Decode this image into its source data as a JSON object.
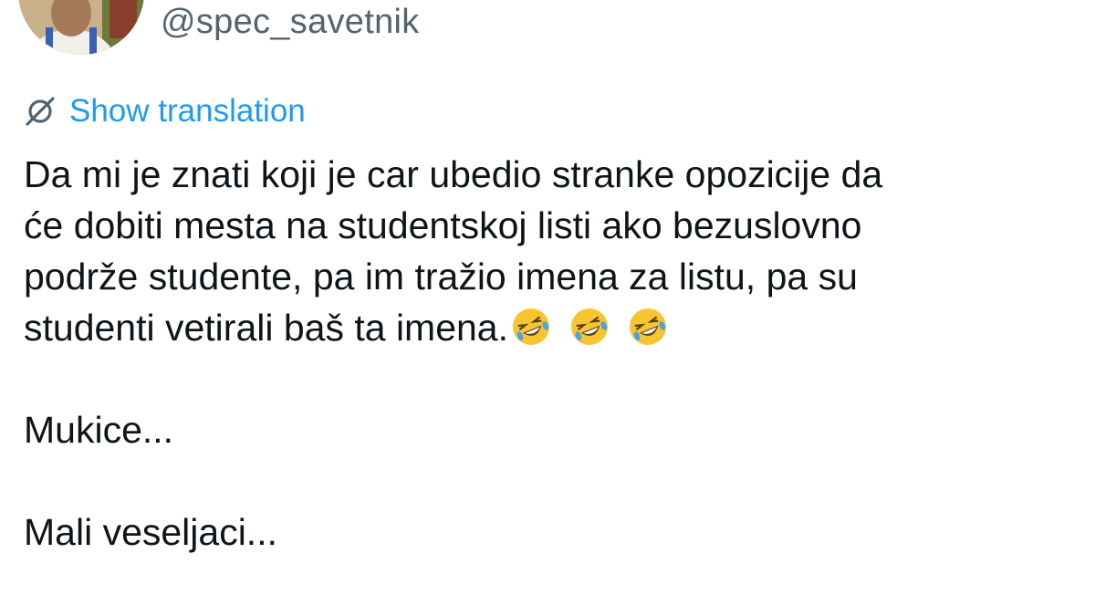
{
  "author": {
    "handle": "@spec_savetnik",
    "avatar_icon": "avatar-photo"
  },
  "translation": {
    "label": "Show translation",
    "icon": "translate-icon",
    "color": "#1d9bf0"
  },
  "tweet": {
    "lines": [
      "Da mi je znati koji je car ubedio stranke opozicije da",
      "će dobiti mesta na studentskoj listi ako bezuslovno",
      "podrže studente, pa im tražio imena za listu, pa su",
      "studenti vetirali baš ta imena."
    ],
    "emojis": [
      "rolling-on-floor-laughing-emoji",
      "rolling-on-floor-laughing-emoji",
      "rolling-on-floor-laughing-emoji"
    ],
    "paragraph2": "Mukice...",
    "paragraph3": "Mali veseljaci..."
  },
  "colors": {
    "text": "#0f1419",
    "secondary": "#536471",
    "link": "#1d9bf0"
  }
}
